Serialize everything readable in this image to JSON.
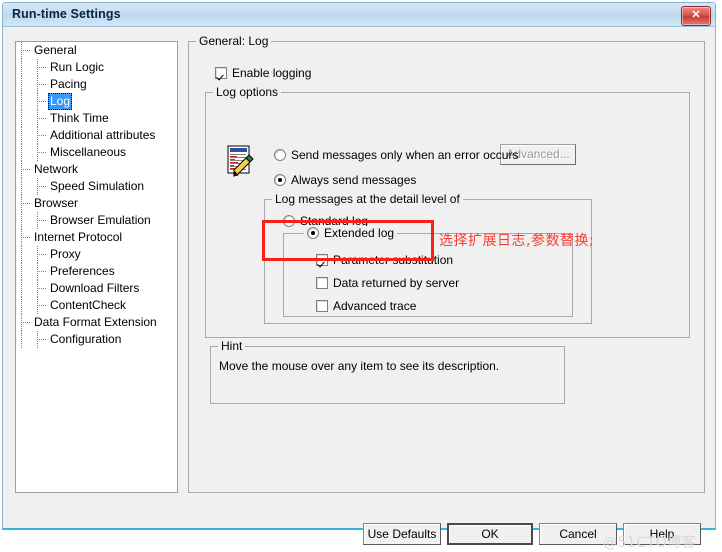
{
  "window": {
    "title": "Run-time Settings",
    "close_label": "✕"
  },
  "tree": {
    "items": [
      {
        "label": "General",
        "level": 0,
        "selected": false
      },
      {
        "label": "Run Logic",
        "level": 1,
        "selected": false
      },
      {
        "label": "Pacing",
        "level": 1,
        "selected": false
      },
      {
        "label": "Log",
        "level": 1,
        "selected": true
      },
      {
        "label": "Think Time",
        "level": 1,
        "selected": false
      },
      {
        "label": "Additional attributes",
        "level": 1,
        "selected": false
      },
      {
        "label": "Miscellaneous",
        "level": 1,
        "selected": false
      },
      {
        "label": "Network",
        "level": 0,
        "selected": false
      },
      {
        "label": "Speed Simulation",
        "level": 1,
        "selected": false
      },
      {
        "label": "Browser",
        "level": 0,
        "selected": false
      },
      {
        "label": "Browser Emulation",
        "level": 1,
        "selected": false
      },
      {
        "label": "Internet Protocol",
        "level": 0,
        "selected": false
      },
      {
        "label": "Proxy",
        "level": 1,
        "selected": false
      },
      {
        "label": "Preferences",
        "level": 1,
        "selected": false
      },
      {
        "label": "Download Filters",
        "level": 1,
        "selected": false
      },
      {
        "label": "ContentCheck",
        "level": 1,
        "selected": false
      },
      {
        "label": "Data Format Extension",
        "level": 0,
        "selected": false
      },
      {
        "label": "Configuration",
        "level": 1,
        "selected": false
      }
    ]
  },
  "main": {
    "group_title": "General: Log",
    "enable_logging": {
      "label": "Enable logging",
      "checked": true
    },
    "log_options": {
      "group_title": "Log options",
      "advanced_button": {
        "label": "Advanced...",
        "enabled": false
      },
      "radios": [
        {
          "label": "Send messages only when an error occurs",
          "checked": false
        },
        {
          "label": "Always send messages",
          "checked": true
        }
      ],
      "detail_level": {
        "group_title": "Log messages at the detail level of",
        "standard": {
          "label": "Standard log",
          "checked": false
        },
        "extended": {
          "label": "Extended log",
          "checked": true
        },
        "extended_options": [
          {
            "label": "Parameter substitution",
            "checked": true
          },
          {
            "label": "Data returned by server",
            "checked": false
          },
          {
            "label": "Advanced trace",
            "checked": false
          }
        ]
      }
    },
    "hint": {
      "group_title": "Hint",
      "text": "Move the mouse over any item to see its description."
    }
  },
  "annotation": {
    "text": "选择扩展日志,参数替换;",
    "color": "#fa3c32"
  },
  "footer": {
    "buttons": [
      {
        "label": "Use Defaults",
        "default": false
      },
      {
        "label": "OK",
        "default": true
      },
      {
        "label": "Cancel",
        "default": false
      },
      {
        "label": "Help",
        "default": false
      }
    ]
  },
  "watermark": {
    "text": "@51CTO博客"
  }
}
